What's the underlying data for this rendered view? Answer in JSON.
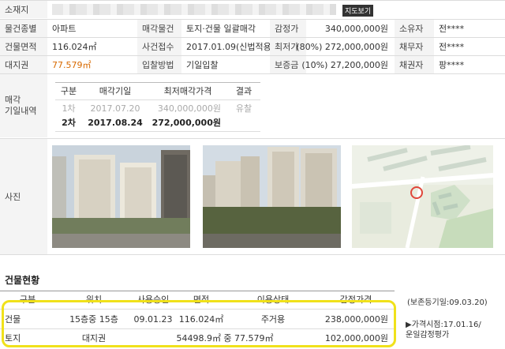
{
  "info": {
    "address_label": "소재지",
    "map_button": "지도보기",
    "rows": [
      {
        "l1": "물건종별",
        "v1": "아파트",
        "l2": "매각물건",
        "v2": "토지·건물 일괄매각",
        "l3": "감정가",
        "v3": "340,000,000원",
        "l4": "소유자",
        "v4": "전****"
      },
      {
        "l1": "건물면적",
        "v1": "116.024㎡",
        "l2": "사건접수",
        "v2": "2017.01.09(신법적용)",
        "l3": "최저가",
        "v3": "(80%) 272,000,000원",
        "l4": "채무자",
        "v4": "전****"
      },
      {
        "l1": "대지권",
        "v1": "77.579㎡",
        "l2": "입찰방법",
        "v2": "기일입찰",
        "l3": "보증금",
        "v3": "(10%) 27,200,000원",
        "l4": "채권자",
        "v4": "팡****"
      }
    ]
  },
  "sale": {
    "label": "매각\n기일내역",
    "headers": [
      "구분",
      "매각기일",
      "최저매각가격",
      "결과"
    ],
    "rows": [
      {
        "round": "1차",
        "date": "2017.07.20",
        "price": "340,000,000원",
        "result": "유찰"
      },
      {
        "round": "2차",
        "date": "2017.08.24",
        "price": "272,000,000원",
        "result": ""
      }
    ]
  },
  "photos": {
    "label": "사진"
  },
  "building": {
    "title": "건물현황",
    "headers": [
      "구분",
      "위치",
      "사용승인",
      "면적",
      "이용상태",
      "감정가격"
    ],
    "note_top": "(보존등기일:09.03.20)",
    "note_bottom": "▶가격시점:17.01.16/\n운일감정평가",
    "rows": [
      {
        "type": "건물",
        "loc": "15층중 15층",
        "approve": "09.01.23",
        "area": "116.024㎡",
        "use": "주거용",
        "price": "238,000,000원"
      },
      {
        "type": "토지",
        "loc": "대지권",
        "area": "54498.9㎡ 중 77.579㎡",
        "price": "102,000,000원"
      }
    ]
  },
  "colors": {
    "highlight": "#f0e11b",
    "accent": "#d86a00"
  }
}
